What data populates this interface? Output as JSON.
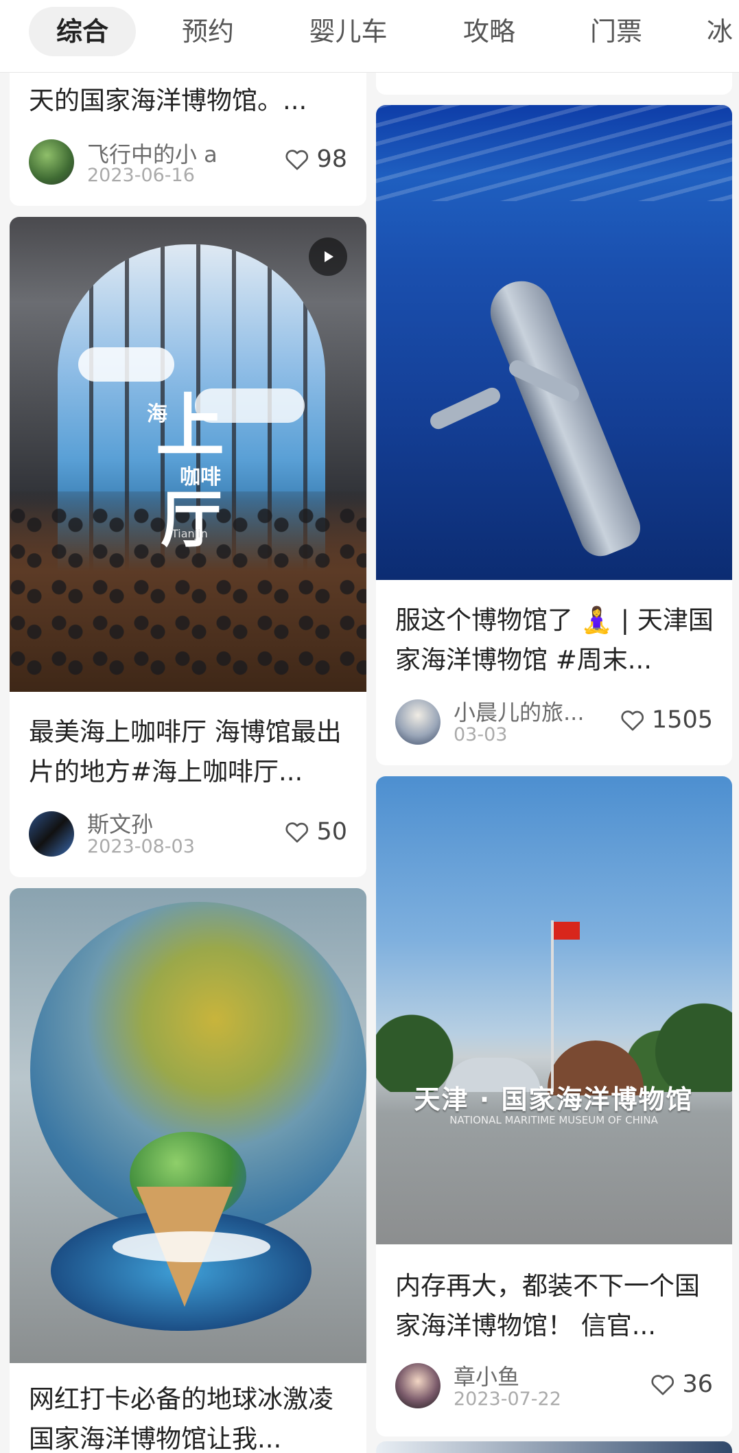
{
  "tabs": [
    {
      "label": "综合",
      "active": true
    },
    {
      "label": "预约"
    },
    {
      "label": "婴儿车"
    },
    {
      "label": "攻略"
    },
    {
      "label": "门票"
    },
    {
      "label": "冰"
    }
  ],
  "left_column": [
    {
      "title": "天的国家海洋博物馆。...",
      "author": "飞行中的小 a",
      "date": "2023-06-16",
      "likes": "98"
    },
    {
      "title": "最美海上咖啡厅 海博馆最出片的地方#海上咖啡厅...",
      "author": "斯文孙",
      "date": "2023-08-03",
      "likes": "50",
      "has_video": true
    },
    {
      "title": "网红打卡必备的地球冰激凌 国家海洋博物馆让我..."
    }
  ],
  "right_column": [
    {
      "title": "服这个博物馆了 🧘‍♀️ | 天津国家海洋博物馆 #周末...",
      "author": "小晨儿的旅...",
      "date": "03-03",
      "likes": "1505"
    },
    {
      "title": "内存再大，都装不下一个国家海洋博物馆！ 信官...",
      "author": "章小鱼",
      "date": "2023-07-22",
      "likes": "36"
    }
  ],
  "image_text": {
    "cafe_big": "上",
    "cafe_small_left": "海",
    "cafe_small": "咖啡",
    "cafe_bottom": "厅",
    "cafe_city": "Tianjin",
    "museum_sign": "天津 · 国家海洋博物馆",
    "museum_sign_en": "NATIONAL MARITIME MUSEUM OF CHINA"
  },
  "icons": {
    "like": "heart-outline-icon",
    "video": "play-icon"
  }
}
